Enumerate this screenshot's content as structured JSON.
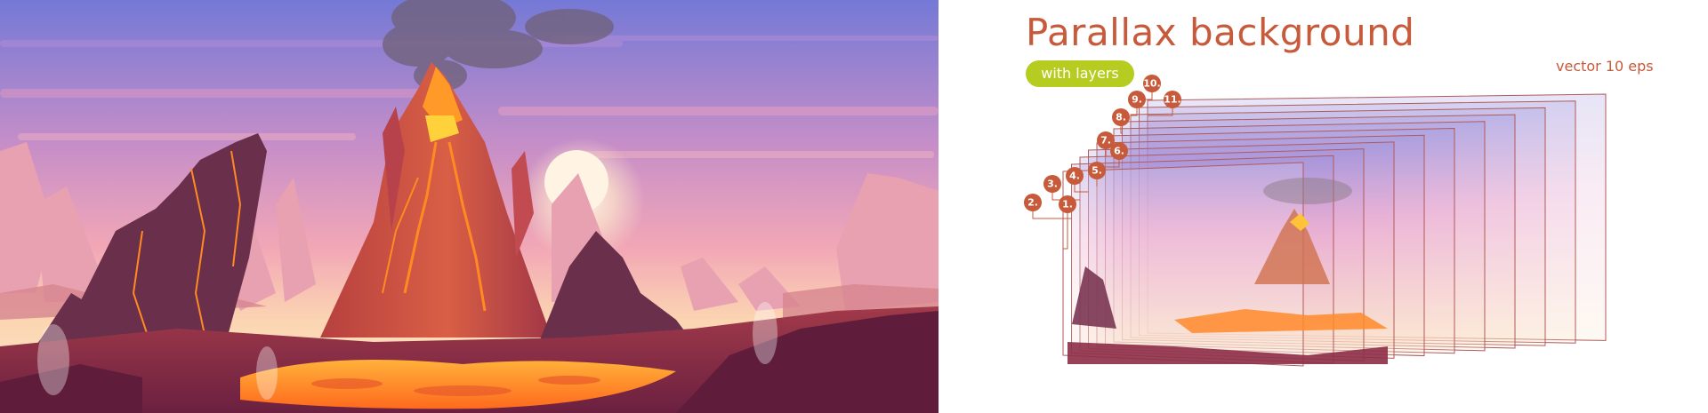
{
  "header": {
    "title": "Parallax background",
    "badge": "with layers",
    "format": "vector 10 eps"
  },
  "layer_labels": [
    "1.",
    "2.",
    "3.",
    "4.",
    "5.",
    "6.",
    "7.",
    "8.",
    "9.",
    "10.",
    "11."
  ],
  "colors": {
    "accent": "#c75a3a",
    "badge": "#b7cc21",
    "sky_top": "#7479d6",
    "sky_mid": "#d88fbf",
    "sky_low": "#fcd6b2",
    "lava": "#ff9a28",
    "rock_dark": "#6a2f4a",
    "rock_light": "#e7a1b0"
  },
  "icons": {
    "volcano": "volcano-illustration",
    "smoke": "smoke-plume",
    "sun": "setting-sun"
  }
}
